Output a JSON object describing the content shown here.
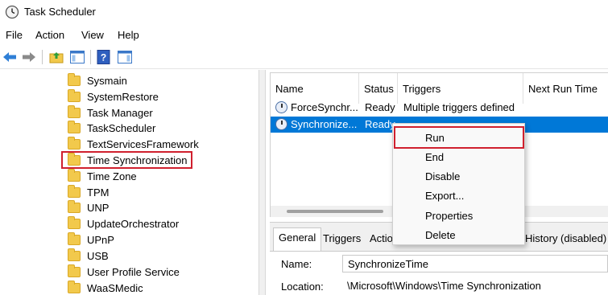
{
  "window": {
    "title": "Task Scheduler"
  },
  "menu": [
    "File",
    "Action",
    "View",
    "Help"
  ],
  "tree": [
    "Sysmain",
    "SystemRestore",
    "Task Manager",
    "TaskScheduler",
    "TextServicesFramework",
    "Time Synchronization",
    "Time Zone",
    "TPM",
    "UNP",
    "UpdateOrchestrator",
    "UPnP",
    "USB",
    "User Profile Service",
    "WaaSMedic"
  ],
  "tree_selected": "Time Synchronization",
  "task_list": {
    "columns": [
      "Name",
      "Status",
      "Triggers",
      "Next Run Time"
    ],
    "rows": [
      {
        "name": "ForceSynchr...",
        "status": "Ready",
        "triggers": "Multiple triggers defined"
      },
      {
        "name": "Synchronize...",
        "status": "Ready",
        "triggers": ""
      }
    ]
  },
  "context_menu": [
    "Run",
    "End",
    "Disable",
    "Export...",
    "Properties",
    "Delete"
  ],
  "details": {
    "tabs": [
      "General",
      "Triggers",
      "Actio",
      "History (disabled)"
    ],
    "name_label": "Name:",
    "name_value": "SynchronizeTime",
    "location_label": "Location:",
    "location_value": "\\Microsoft\\Windows\\Time Synchronization"
  },
  "colors": {
    "selection": "#0078d7",
    "highlight_box": "#d0202e",
    "folder": "#f2c94c"
  }
}
